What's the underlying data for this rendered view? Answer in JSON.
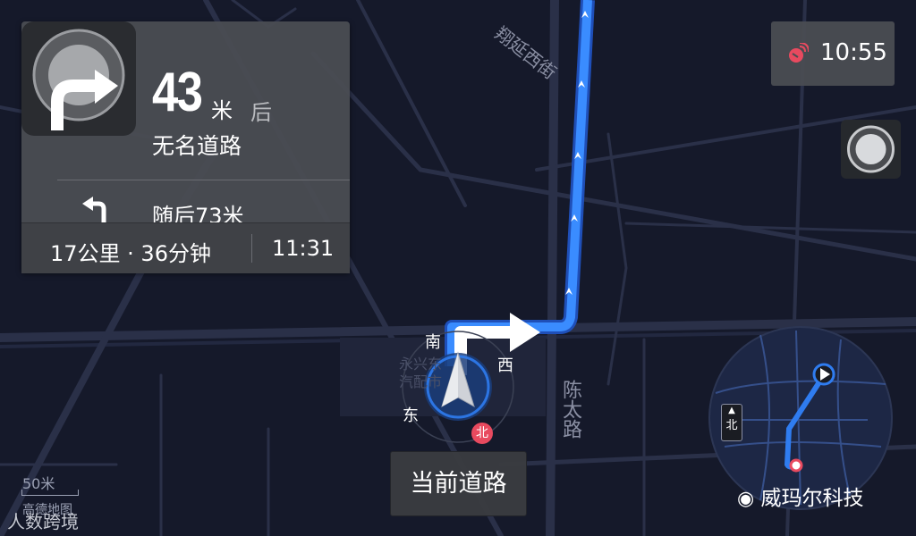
{
  "nav": {
    "distance_value": "43",
    "distance_unit": "米",
    "distance_suffix": "后",
    "road_name": "无名道路",
    "next_instruction": "随后73米",
    "remaining": "17公里 · 36分钟",
    "eta": "11:31"
  },
  "status": {
    "time": "10:55"
  },
  "map": {
    "road_labels": {
      "north": "翔延西街",
      "south": "陈太路",
      "poi": "永兴东汽配市"
    },
    "compass": {
      "south": "南",
      "west": "西",
      "east": "东",
      "north": "北"
    },
    "scale": "50米",
    "provider": "高德地图"
  },
  "current_road_button": "当前道路",
  "minimap": {
    "north": "北"
  },
  "watermarks": {
    "left": "人数跨境",
    "right": "威玛尔科技"
  },
  "colors": {
    "route": "#2f7cf0",
    "background": "#15192a",
    "panel": "#4a4c52",
    "badge": "#e84a5f"
  }
}
